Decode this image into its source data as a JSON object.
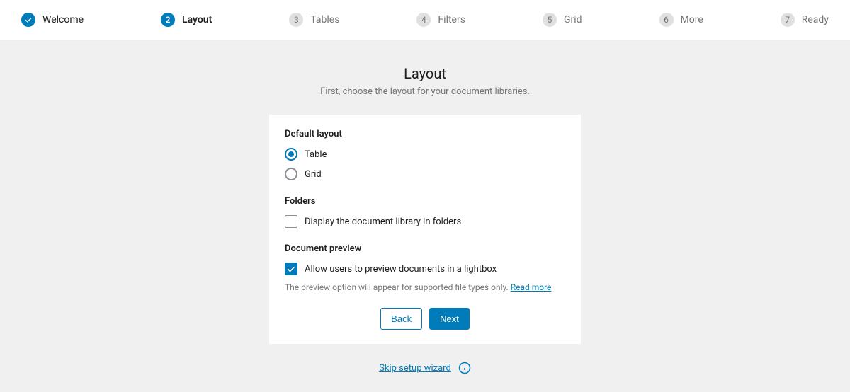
{
  "stepper": {
    "steps": [
      {
        "label": "Welcome",
        "state": "completed"
      },
      {
        "label": "Layout",
        "state": "active",
        "num": "2"
      },
      {
        "label": "Tables",
        "state": "pending",
        "num": "3"
      },
      {
        "label": "Filters",
        "state": "pending",
        "num": "4"
      },
      {
        "label": "Grid",
        "state": "pending",
        "num": "5"
      },
      {
        "label": "More",
        "state": "pending",
        "num": "6"
      },
      {
        "label": "Ready",
        "state": "pending",
        "num": "7"
      }
    ]
  },
  "header": {
    "title": "Layout",
    "subtitle": "First, choose the layout for your document libraries."
  },
  "sections": {
    "default_layout": {
      "heading": "Default layout",
      "options": {
        "table": "Table",
        "grid": "Grid"
      }
    },
    "folders": {
      "heading": "Folders",
      "checkbox_label": "Display the document library in folders"
    },
    "preview": {
      "heading": "Document preview",
      "checkbox_label": "Allow users to preview documents in a lightbox",
      "hint": "The preview option will appear for supported file types only. ",
      "hint_link": "Read more"
    }
  },
  "buttons": {
    "back": "Back",
    "next": "Next"
  },
  "footer": {
    "skip": "Skip setup wizard"
  }
}
